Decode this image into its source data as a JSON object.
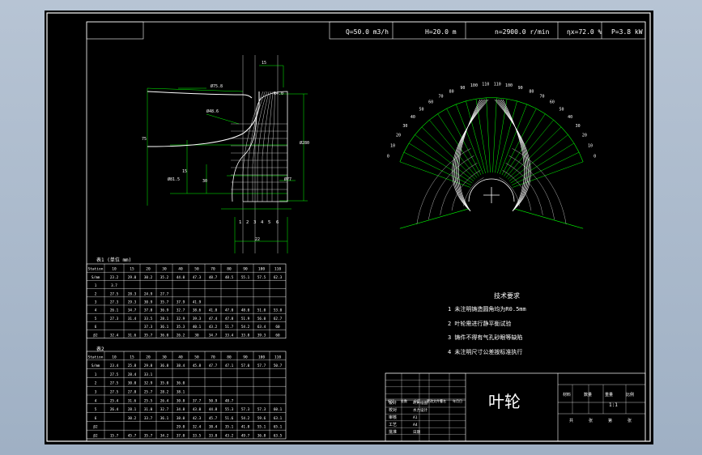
{
  "header": {
    "flow": "Q=50.0 m3/h",
    "head": "H=20.0 m",
    "speed": "n=2900.0 r/min",
    "efficiency": "ηx=72.0 %",
    "power": "P=3.8 kW"
  },
  "meridional": {
    "dim_top": "15",
    "dims_left": [
      "Ø75.8",
      "Ø48.6",
      "Ø81.5",
      "75",
      "15",
      "30"
    ],
    "dims_right": [
      "Ø280",
      "R4.0",
      "Ø77"
    ],
    "dim_bottom": "22",
    "station_numbers": [
      "1",
      "2",
      "3",
      "4",
      "5",
      "6"
    ]
  },
  "front_view": {
    "angle_labels": [
      "0",
      "10",
      "20",
      "30",
      "40",
      "50",
      "60",
      "70",
      "80",
      "90",
      "100",
      "110",
      "110",
      "100",
      "90",
      "80",
      "70",
      "60",
      "50",
      "40",
      "30",
      "20",
      "10",
      "0"
    ]
  },
  "notes": {
    "title": "技术要求",
    "items": [
      "1 未注明铸造圆角均为R0.5mm",
      "2 叶轮需进行静平衡试验",
      "3 铸件不得有气孔砂眼等缺陷",
      "4 未注明尺寸公差按标准执行"
    ]
  },
  "table1": {
    "caption": "表1 (单位 mm)",
    "columns": [
      "Station",
      "10",
      "15",
      "20",
      "30",
      "40",
      "50",
      "70",
      "80",
      "90",
      "100",
      "110"
    ],
    "rows": [
      [
        "S/mm",
        "23.2",
        "29.0",
        "30.2",
        "35.2",
        "44.0",
        "47.3",
        "48.7",
        "48.5",
        "55.1",
        "57.5",
        "62.3",
        "63"
      ],
      [
        "1",
        "3.7",
        "",
        "",
        "",
        "",
        "",
        "",
        "",
        "",
        "",
        "",
        ""
      ],
      [
        "2",
        "27.5",
        "28.3",
        "24.9",
        "27.7",
        "",
        "",
        "",
        "",
        "",
        "",
        "",
        ""
      ],
      [
        "3",
        "27.3",
        "29.3",
        "30.9",
        "35.7",
        "37.9",
        "41.9",
        "",
        "",
        "",
        "",
        "",
        ""
      ],
      [
        "4",
        "26.1",
        "34.7",
        "37.8",
        "36.9",
        "32.7",
        "38.6",
        "41.8",
        "47.0",
        "48.0",
        "51.0",
        "53.0",
        "60"
      ],
      [
        "5",
        "27.3",
        "31.4",
        "33.5",
        "28.1",
        "32.9",
        "39.3",
        "47.4",
        "47.8",
        "51.9",
        "56.0",
        "62.7",
        "60"
      ],
      [
        "6",
        "",
        "",
        "37.3",
        "36.1",
        "35.3",
        "40.1",
        "43.2",
        "51.7",
        "54.2",
        "63.4",
        "60",
        ""
      ],
      [
        "β2",
        "32.4",
        "31.6",
        "35.7",
        "36.0",
        "26.2",
        "30",
        "34.7",
        "33.4",
        "33.8",
        "39.3",
        "60",
        ""
      ]
    ]
  },
  "table2": {
    "caption": "表2",
    "columns": [
      "Station",
      "10",
      "15",
      "20",
      "30",
      "40",
      "50",
      "70",
      "80",
      "90",
      "100",
      "110"
    ],
    "rows": [
      [
        "S/mm",
        "23.4",
        "25.8",
        "29.8",
        "36.8",
        "38.4",
        "45.8",
        "47.7",
        "47.1",
        "57.0",
        "57.7",
        "50.7"
      ],
      [
        "1",
        "27.5",
        "28.4",
        "33.1",
        "",
        "",
        "",
        "",
        "",
        "",
        "",
        ""
      ],
      [
        "2",
        "27.5",
        "30.0",
        "32.9",
        "35.0",
        "36.0",
        "",
        "",
        "",
        "",
        "",
        ""
      ],
      [
        "3",
        "27.5",
        "27.8",
        "25.7",
        "28.2",
        "38.1",
        "",
        "",
        "",
        "",
        "",
        ""
      ],
      [
        "4",
        "25.4",
        "31.6",
        "25.5",
        "26.4",
        "30.8",
        "37.7",
        "50.9",
        "48.7",
        "",
        "",
        ""
      ],
      [
        "5",
        "26.4",
        "28.1",
        "31.0",
        "32.7",
        "34.8",
        "43.0",
        "44.8",
        "55.3",
        "57.3",
        "57.3",
        "60.1"
      ],
      [
        "6",
        "",
        "30.2",
        "33.7",
        "36.1",
        "38.0",
        "42.3",
        "45.7",
        "51.6",
        "54.2",
        "59.6",
        "63.1"
      ],
      [
        "β2",
        "",
        "",
        "",
        "",
        "29.0",
        "32.4",
        "38.4",
        "35.1",
        "41.8",
        "55.1",
        "65.1"
      ],
      [
        "β2",
        "15.7",
        "45.7",
        "35.7",
        "34.2",
        "37.0",
        "33.5",
        "33.8",
        "43.2",
        "49.7",
        "36.8",
        "63.5"
      ]
    ]
  },
  "title_block": {
    "name": "叶轮",
    "left_rows": [
      "设计",
      "校对",
      "审核",
      "工艺",
      "批准"
    ],
    "left_values": [
      "叶片绘图",
      "水力设计",
      "A1",
      "A4",
      "日期"
    ],
    "mark_scale": [
      "材料",
      "数量",
      "重量",
      "比例"
    ],
    "scale": "1:1",
    "sheet": [
      "共",
      "张",
      "第",
      "张"
    ],
    "revision_row": [
      "标记",
      "处数",
      "分区",
      "更改文件号",
      "签名",
      "年月日"
    ]
  },
  "colors": {
    "outline": "#ffffff",
    "construction": "#00ff00",
    "dimension": "#00ff00",
    "centerline": "#ffffff"
  }
}
